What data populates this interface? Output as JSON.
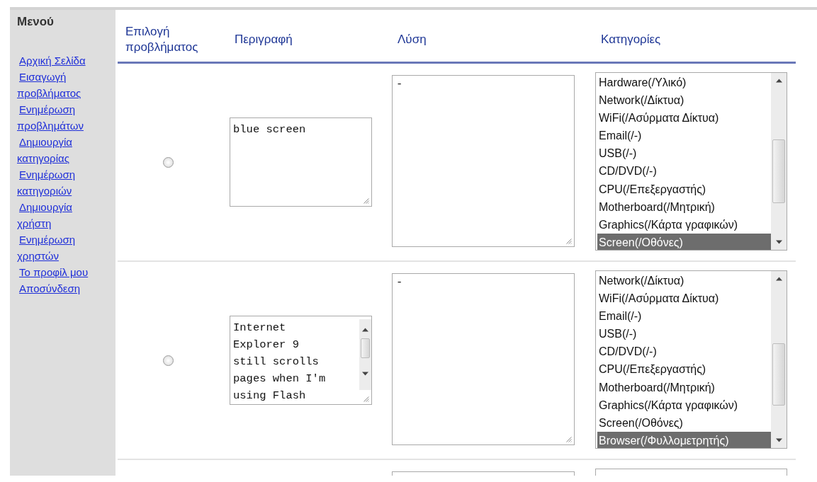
{
  "sidebar": {
    "title": "Μενού",
    "links": [
      {
        "label": "Αρχική Σελίδα"
      },
      {
        "label": "Εισαγωγή προβλήματος"
      },
      {
        "label": "Ενημέρωση προβλημάτων"
      },
      {
        "label": "Δημιουργία κατηγορίας"
      },
      {
        "label": "Ενημέρωση κατηγοριών"
      },
      {
        "label": "Δημιουργία χρήστη"
      },
      {
        "label": "Ενημέρωση χρηστών"
      },
      {
        "label": "Το προφίλ μου"
      },
      {
        "label": "Αποσύνδεση"
      }
    ]
  },
  "table": {
    "columns": [
      "Επιλογή προβλήματος",
      "Περιγραφή",
      "Λύση",
      "Κατηγορίες"
    ],
    "rows": [
      {
        "selected": false,
        "description": "blue screen",
        "solution": "-",
        "categories": [
          {
            "label": "Hardware(/Υλικό)",
            "selected": false
          },
          {
            "label": "Network(/Δίκτυα)",
            "selected": false
          },
          {
            "label": "WiFi(/Ασύρματα Δίκτυα)",
            "selected": false
          },
          {
            "label": "Email(/-)",
            "selected": false
          },
          {
            "label": "USB(/-)",
            "selected": false
          },
          {
            "label": "CD/DVD(/-)",
            "selected": false
          },
          {
            "label": "CPU(/Επεξεργαστής)",
            "selected": false
          },
          {
            "label": "Motherboard(/Μητρική)",
            "selected": false
          },
          {
            "label": "Graphics(/Κάρτα γραφικών)",
            "selected": false
          },
          {
            "label": "Screen(/Οθόνες)",
            "selected": true
          }
        ]
      },
      {
        "selected": false,
        "description": "Internet Explorer 9 still scrolls pages when I'm using Flash",
        "solution": "-",
        "categories": [
          {
            "label": "Network(/Δίκτυα)",
            "selected": false
          },
          {
            "label": "WiFi(/Ασύρματα Δίκτυα)",
            "selected": false
          },
          {
            "label": "Email(/-)",
            "selected": false
          },
          {
            "label": "USB(/-)",
            "selected": false
          },
          {
            "label": "CD/DVD(/-)",
            "selected": false
          },
          {
            "label": "CPU(/Επεξεργαστής)",
            "selected": false
          },
          {
            "label": "Motherboard(/Μητρική)",
            "selected": false
          },
          {
            "label": "Graphics(/Κάρτα γραφικών)",
            "selected": false
          },
          {
            "label": "Screen(/Οθόνες)",
            "selected": false
          },
          {
            "label": "Browser(/Φυλλομετρητής)",
            "selected": true
          }
        ]
      }
    ],
    "more_rows_below": true
  }
}
